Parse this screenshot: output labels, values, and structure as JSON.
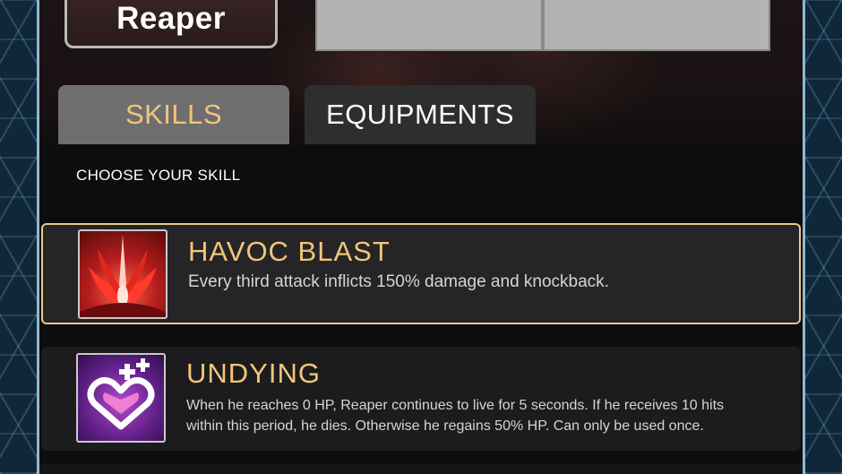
{
  "hero": {
    "name": "Reaper"
  },
  "tabs": [
    {
      "label": "SKILLS",
      "active": true
    },
    {
      "label": "EQUIPMENTS",
      "active": false
    }
  ],
  "section_title": "CHOOSE YOUR SKILL",
  "skills": [
    {
      "name": "HAVOC BLAST",
      "description": "Every third attack inflicts 150% damage and knockback.",
      "icon": "havoc-blast-icon",
      "selected": true
    },
    {
      "name": "UNDYING",
      "description_lines": [
        "When he reaches 0 HP, Reaper continues to live for 5 seconds. If he receives 10 hits",
        "within this period, he dies. Otherwise he regains 50% HP. Can only be used once."
      ],
      "icon": "undying-icon",
      "selected": false
    }
  ],
  "colors": {
    "accent_gold": "#f2c57a",
    "selected_border": "#e7c98a",
    "tab_active_bg": "#6e6e6e",
    "tab_inactive_bg": "#2e2e2e",
    "frame_blue": "#10273a"
  }
}
